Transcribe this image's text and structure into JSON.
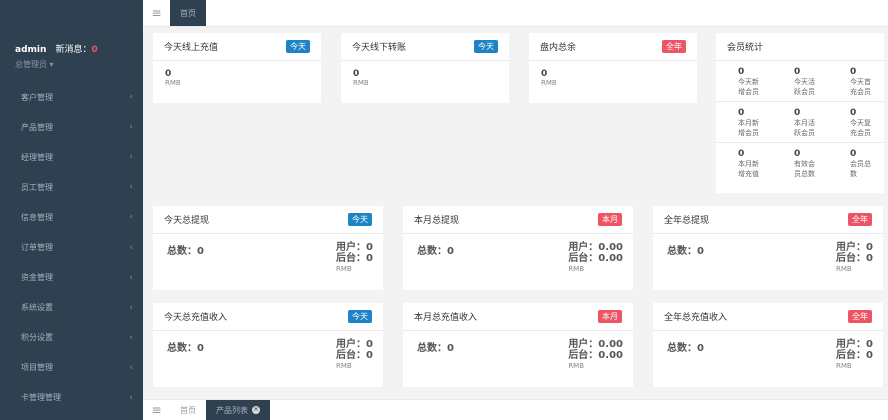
{
  "sidebar": {
    "username": "admin",
    "msg_label": "新消息：",
    "msg_count": "0",
    "role": "总管理员",
    "items": [
      {
        "label": "客户管理"
      },
      {
        "label": "产品管理"
      },
      {
        "label": "经理管理"
      },
      {
        "label": "员工管理"
      },
      {
        "label": "信息管理"
      },
      {
        "label": "订单管理"
      },
      {
        "label": "资金管理"
      },
      {
        "label": "系统设置"
      },
      {
        "label": "积分设置"
      },
      {
        "label": "项目管理"
      },
      {
        "label": "卡管理管理"
      }
    ]
  },
  "topbar": {
    "menu_icon": "≡",
    "tab_home": "首页"
  },
  "bottombar": {
    "menu_icon": "≡",
    "tab_home": "首页",
    "tab_product": "产品列表"
  },
  "cards_top": [
    {
      "title": "今天线上充值",
      "badge": "今天",
      "value": "0",
      "unit": "RMB"
    },
    {
      "title": "今天线下转账",
      "badge": "今天",
      "value": "0",
      "unit": "RMB"
    },
    {
      "title": "盘内总余",
      "badge": "全年",
      "value": "0",
      "unit": "RMB"
    }
  ],
  "members": {
    "title": "会员统计",
    "rows": [
      [
        {
          "value": "0",
          "l1": "今天新",
          "l2": "增会员"
        },
        {
          "value": "0",
          "l1": "今天活",
          "l2": "跃会员"
        },
        {
          "value": "0",
          "l1": "今天首",
          "l2": "充会员"
        }
      ],
      [
        {
          "value": "0",
          "l1": "本月新",
          "l2": "增会员"
        },
        {
          "value": "0",
          "l1": "本月活",
          "l2": "跃会员"
        },
        {
          "value": "0",
          "l1": "今天复",
          "l2": "充会员"
        }
      ],
      [
        {
          "value": "0",
          "l1": "本月新",
          "l2": "增充值"
        },
        {
          "value": "0",
          "l1": "有效会",
          "l2": "员总数"
        },
        {
          "value": "0",
          "l1": "会员总",
          "l2": "数"
        }
      ]
    ]
  },
  "withdraw": [
    {
      "title": "今天总提现",
      "badge": "今天",
      "total": "总数：0",
      "user": "用户：0",
      "backend": "后台：0",
      "unit": "RMB"
    },
    {
      "title": "本月总提现",
      "badge": "本月",
      "total": "总数：0",
      "user": "用户：0.00",
      "backend": "后台：0.00",
      "unit": "RMB"
    },
    {
      "title": "全年总提现",
      "badge": "全年",
      "total": "总数：0",
      "user": "用户：0",
      "backend": "后台：0",
      "unit": "RMB"
    }
  ],
  "recharge": [
    {
      "title": "今天总充值收入",
      "badge": "今天",
      "total": "总数：0",
      "user": "用户：0",
      "backend": "后台：0",
      "unit": "RMB"
    },
    {
      "title": "本月总充值收入",
      "badge": "本月",
      "total": "总数：0",
      "user": "用户：0.00",
      "backend": "后台：0.00",
      "unit": "RMB"
    },
    {
      "title": "全年总充值收入",
      "badge": "全年",
      "total": "总数：0",
      "user": "用户：0",
      "backend": "后台：0",
      "unit": "RMB"
    }
  ]
}
